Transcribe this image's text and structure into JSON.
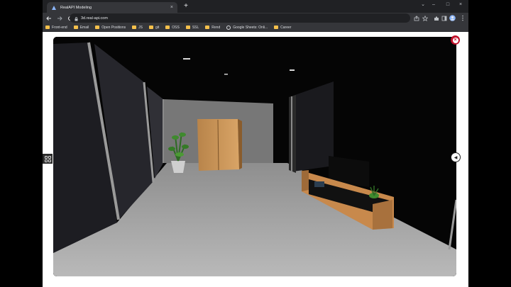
{
  "tab": {
    "title": "RealAPI Modeling",
    "close": "×"
  },
  "window": {
    "new_tab": "+",
    "minimize": "–",
    "maximize": "□",
    "close": "×",
    "collapse": "⌄"
  },
  "address_bar": {
    "url": "3d.real-api.com"
  },
  "bookmarks": [
    {
      "label": "Front-end",
      "icon": "folder-icon"
    },
    {
      "label": "Email",
      "icon": "folder-icon"
    },
    {
      "label": "Open Positions",
      "icon": "folder-icon"
    },
    {
      "label": "JS",
      "icon": "folder-icon"
    },
    {
      "label": "git",
      "icon": "folder-icon"
    },
    {
      "label": "OSS",
      "icon": "folder-icon"
    },
    {
      "label": "SSL",
      "icon": "folder-icon"
    },
    {
      "label": "Rend",
      "icon": "folder-icon"
    },
    {
      "label": "Google Sheets: Onli...",
      "icon": "globe-icon"
    },
    {
      "label": "Career",
      "icon": "folder-icon"
    }
  ],
  "viewer": {
    "close_symbol": "×",
    "arrow_symbol": "◀"
  },
  "colors": {
    "close_accent": "#c0102a",
    "folder": "#f6c14b",
    "chrome_dark": "#202124",
    "chrome_mid": "#35363a"
  }
}
